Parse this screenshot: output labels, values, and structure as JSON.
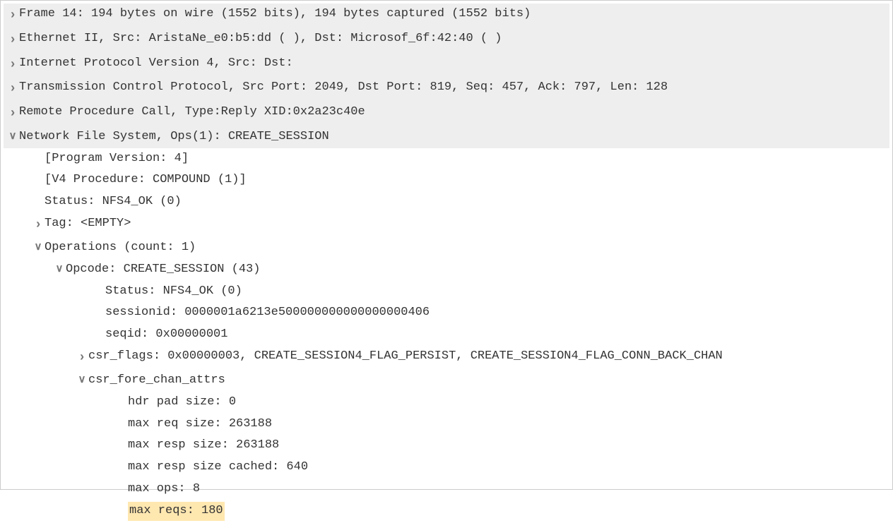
{
  "rows": {
    "frame_summary": "Frame 14: 194 bytes on wire (1552 bits), 194 bytes captured (1552 bits)",
    "ethernet": "Ethernet II, Src: AristaNe_e0:b5:dd (                  ), Dst: Microsof_6f:42:40 (                  )",
    "ip": "Internet Protocol Version 4, Src:            Dst:",
    "tcp": "Transmission Control Protocol, Src Port: 2049, Dst Port: 819, Seq: 457, Ack: 797, Len: 128",
    "rpc": "Remote Procedure Call, Type:Reply XID:0x2a23c40e",
    "nfs": "Network File System, Ops(1): CREATE_SESSION",
    "program_version": "[Program Version: 4]",
    "v4_procedure": "[V4 Procedure: COMPOUND (1)]",
    "status": "Status: NFS4_OK (0)",
    "tag": "Tag: <EMPTY>",
    "operations": "Operations (count: 1)",
    "opcode": "Opcode: CREATE_SESSION (43)",
    "op_status": "Status: NFS4_OK (0)",
    "sessionid": "sessionid: 0000001a6213e500000000000000000406",
    "seqid": "seqid: 0x00000001",
    "csr_flags": "csr_flags: 0x00000003, CREATE_SESSION4_FLAG_PERSIST, CREATE_SESSION4_FLAG_CONN_BACK_CHAN",
    "csr_fore_chan": "csr_fore_chan_attrs",
    "hdr_pad": "hdr pad size: 0",
    "max_req_size": "max req size: 263188",
    "max_resp_size": "max resp size: 263188",
    "max_resp_size_cached": "max resp size cached: 640",
    "max_ops": "max ops: 8",
    "max_reqs": "max reqs: 180"
  }
}
